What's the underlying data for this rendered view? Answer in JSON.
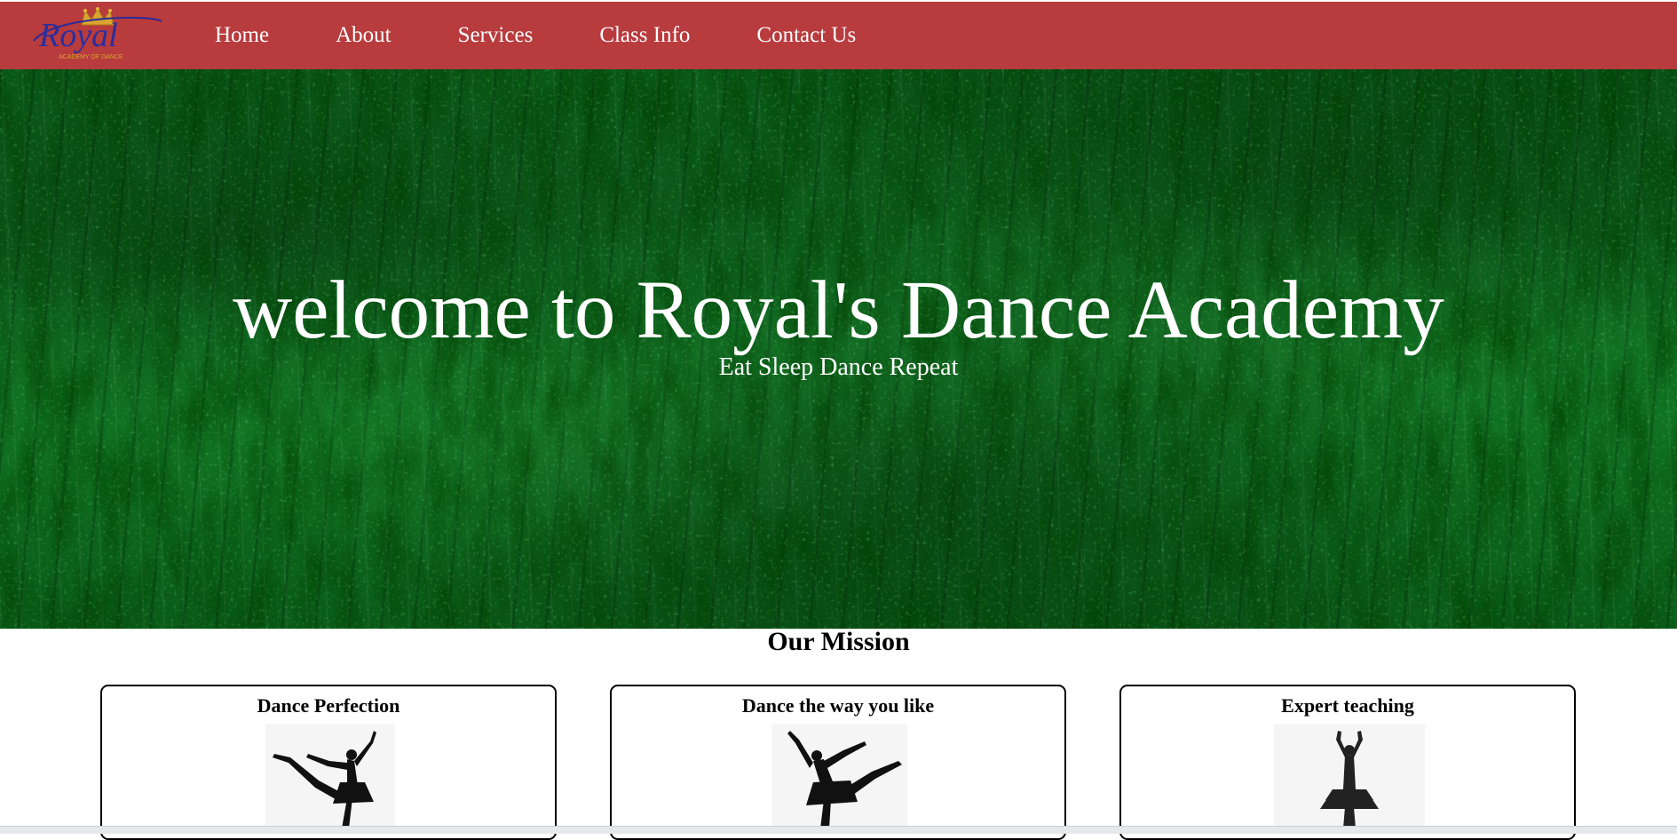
{
  "nav": {
    "logo": {
      "text": "Royal",
      "subtext": "ACADEMY OF DANCE",
      "icon": "crown-icon"
    },
    "links": [
      {
        "label": "Home"
      },
      {
        "label": "About"
      },
      {
        "label": "Services"
      },
      {
        "label": "Class Info"
      },
      {
        "label": "Contact Us"
      }
    ],
    "colors": {
      "bar": "#b83b3d",
      "link": "#ffffff"
    }
  },
  "hero": {
    "title": "welcome to Royal's Dance Academy",
    "subtitle": "Eat Sleep Dance Repeat",
    "background": "green-textured-wall"
  },
  "mission": {
    "heading": "Our Mission",
    "cards": [
      {
        "title": "Dance Perfection",
        "icon": "ballerina-arabesque-icon"
      },
      {
        "title": "Dance the way you like",
        "icon": "ballerina-leap-icon"
      },
      {
        "title": "Expert teaching",
        "icon": "ballerina-arms-up-icon"
      }
    ]
  }
}
